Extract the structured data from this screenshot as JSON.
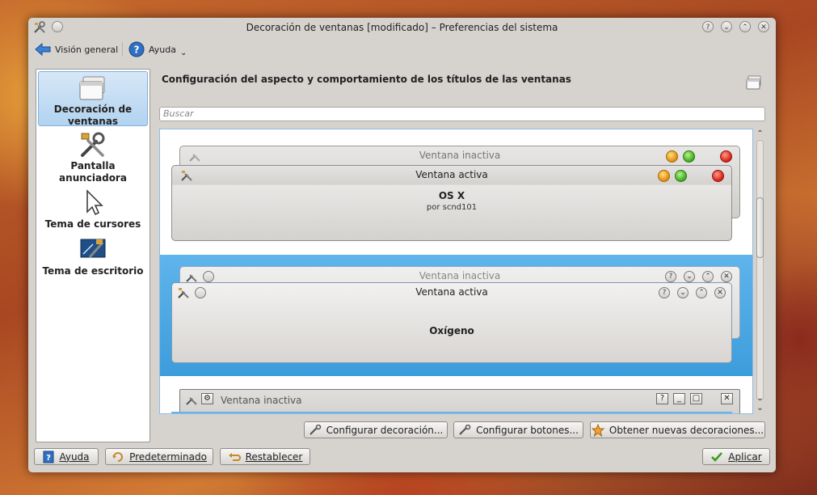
{
  "window": {
    "title": "Decoración de ventanas [modificado] – Preferencias del sistema"
  },
  "toolbar": {
    "overview_label": "Visión general",
    "help_label": "Ayuda"
  },
  "sidebar": {
    "items": [
      {
        "label": "Decoración de ventanas",
        "icon": "window-decoration-icon",
        "selected": true
      },
      {
        "label": "Pantalla anunciadora",
        "icon": "tools-icon",
        "selected": false
      },
      {
        "label": "Tema de cursores",
        "icon": "cursor-icon",
        "selected": false
      },
      {
        "label": "Tema de escritorio",
        "icon": "desktop-theme-icon",
        "selected": false
      }
    ]
  },
  "main": {
    "heading": "Configuración del aspecto y comportamiento de los títulos de las ventanas",
    "search_placeholder": "Buscar"
  },
  "decorations": [
    {
      "name": "OS X",
      "author": "por scnd101",
      "inactive_title": "Ventana inactiva",
      "active_title": "Ventana activa",
      "selected": false
    },
    {
      "name": "Oxígeno",
      "inactive_title": "Ventana inactiva",
      "active_title": "Ventana activa",
      "selected": true
    },
    {
      "inactive_title": "Ventana inactiva",
      "selected": false
    }
  ],
  "actions": {
    "configure_decoration": "Configurar decoración...",
    "configure_buttons": "Configurar botones...",
    "get_new": "Obtener nuevas decoraciones..."
  },
  "footer": {
    "help": "Ayuda",
    "defaults": "Predeterminado",
    "reset": "Restablecer",
    "apply": "Aplicar"
  },
  "colors": {
    "selection": "#3c9ddc",
    "window_bg": "#d6d3cf"
  }
}
